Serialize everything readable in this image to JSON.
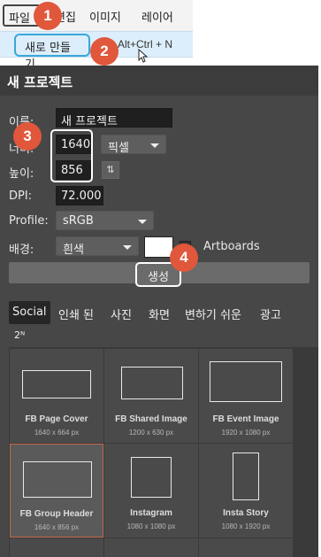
{
  "menu": {
    "items": [
      "파일",
      "편집",
      "이미지",
      "레이어"
    ],
    "dropdown": {
      "new_label": "새로 만들기...",
      "shortcut": "Alt+Ctrl + N"
    }
  },
  "dialog": {
    "title": "새 프로젝트",
    "name": {
      "label": "이름:",
      "value": "새 프로젝트"
    },
    "width": {
      "label": "너비:",
      "value": "1640",
      "unit": "픽셀"
    },
    "height": {
      "label": "높이:",
      "value": "856"
    },
    "dpi": {
      "label": "DPI:",
      "value": "72.000"
    },
    "profile": {
      "label": "Profile:",
      "value": "sRGB"
    },
    "background": {
      "label": "배경:",
      "value": "흰색",
      "color": "#ffffff"
    },
    "artboards_label": "Artboards",
    "create_label": "생성",
    "tabs": [
      "Social",
      "인쇄 된",
      "사진",
      "화면",
      "변하기 쉬운",
      "광고"
    ],
    "tab_more": "2ᴺ",
    "templates": [
      {
        "name": "FB Page Cover",
        "size": "1640 x 664 px"
      },
      {
        "name": "FB Shared Image",
        "size": "1200 x 630 px"
      },
      {
        "name": "FB Event Image",
        "size": "1920 x 1080 px"
      },
      {
        "name": "FB Group Header",
        "size": "1640 x 856 px"
      },
      {
        "name": "Instagram",
        "size": "1080 x 1080 px"
      },
      {
        "name": "Insta Story",
        "size": "1080 x 1920 px"
      }
    ]
  },
  "annotations": [
    "1",
    "2",
    "3",
    "4"
  ],
  "colors": {
    "badge": "#e0573c",
    "dialog_bg": "#474747",
    "highlight": "#3aa7d9"
  }
}
